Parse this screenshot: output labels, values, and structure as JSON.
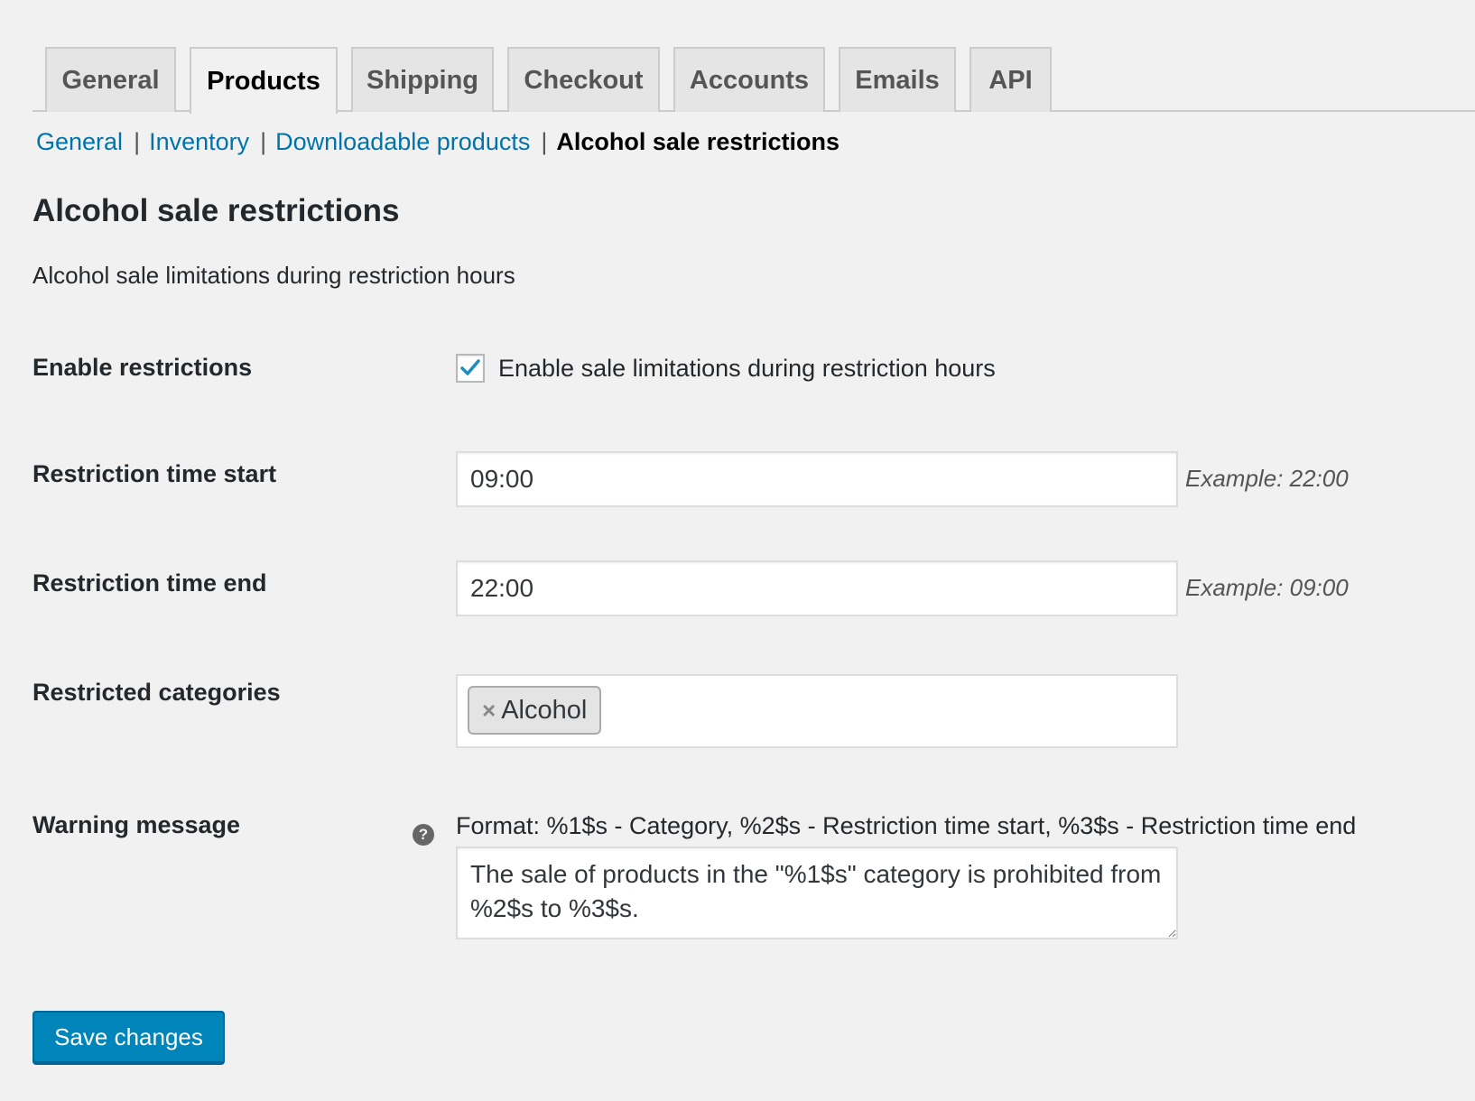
{
  "tabs": [
    {
      "label": "General",
      "active": false
    },
    {
      "label": "Products",
      "active": true
    },
    {
      "label": "Shipping",
      "active": false
    },
    {
      "label": "Checkout",
      "active": false
    },
    {
      "label": "Accounts",
      "active": false
    },
    {
      "label": "Emails",
      "active": false
    },
    {
      "label": "API",
      "active": false
    }
  ],
  "subnav": {
    "links": [
      "General",
      "Inventory",
      "Downloadable products"
    ],
    "separator": "|",
    "current": "Alcohol sale restrictions"
  },
  "section": {
    "title": "Alcohol sale restrictions",
    "description": "Alcohol sale limitations during restriction hours"
  },
  "fields": {
    "enable": {
      "label": "Enable restrictions",
      "checkbox_label": "Enable sale limitations during restriction hours",
      "checked": true
    },
    "time_start": {
      "label": "Restriction time start",
      "value": "09:00",
      "example": "Example: 22:00"
    },
    "time_end": {
      "label": "Restriction time end",
      "value": "22:00",
      "example": "Example: 09:00"
    },
    "categories": {
      "label": "Restricted categories",
      "selected": [
        "Alcohol"
      ],
      "remove_glyph": "×"
    },
    "warning": {
      "label": "Warning message",
      "help_glyph": "?",
      "format": "Format: %1$s - Category, %2$s - Restriction time start, %3$s - Restriction time end",
      "value": "The sale of products in the \"%1$s\" category is prohibited from %2$s to %3$s."
    }
  },
  "save_button": "Save changes",
  "colors": {
    "background": "#f1f1f1",
    "link": "#0073aa",
    "primary_button": "#0085ba",
    "checkmark": "#1e8cbe"
  }
}
